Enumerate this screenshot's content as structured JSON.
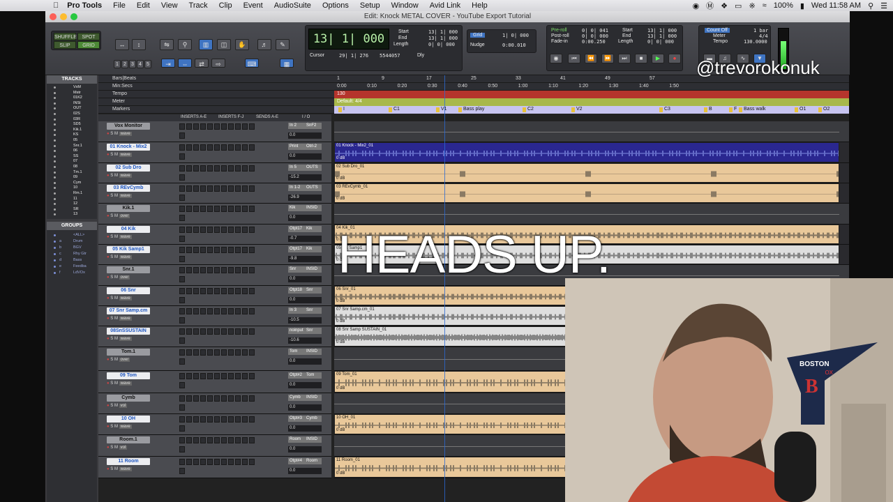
{
  "menubar": {
    "app": "Pro Tools",
    "items": [
      "File",
      "Edit",
      "View",
      "Track",
      "Clip",
      "Event",
      "AudioSuite",
      "Options",
      "Setup",
      "Window",
      "Avid Link",
      "Help"
    ],
    "battery": "100%",
    "clock": "Wed 11:58 AM"
  },
  "window": {
    "title": "Edit: Knock METAL COVER - YouTube Export Tutorial"
  },
  "toolbar": {
    "modes": [
      "SHUFFLE",
      "SPOT",
      "SLIP",
      "GRID"
    ],
    "zoom_presets": [
      "1",
      "2",
      "3",
      "4",
      "5"
    ],
    "main_counter": "13| 1| 000",
    "cursor_label": "Cursor",
    "cursor_value": "29| 1| 276",
    "sample_value": "5544057",
    "selection": {
      "start_label": "Start",
      "end_label": "End",
      "length_label": "Length",
      "start": "13| 1| 000",
      "end": "13| 1| 000",
      "length": "0| 0| 000"
    },
    "dly_label": "Dly",
    "grid_label": "Grid",
    "grid_value": "1| 0| 000",
    "nudge_label": "Nudge",
    "nudge_value": "0:00.010",
    "transport": {
      "preroll_label": "Pre-roll",
      "postroll_label": "Post-roll",
      "fadein_label": "Fade-in",
      "preroll": "0| 0| 041",
      "postroll": "0| 0| 000",
      "fadein": "0:00.250",
      "start_label": "Start",
      "end_label": "End",
      "length_label": "Length",
      "start": "13| 1| 000",
      "end": "13| 1| 000",
      "length": "0| 0| 000"
    },
    "countoff_label": "Count Off",
    "countoff_value": "1 bar",
    "meter_label": "Meter",
    "meter_value": "4/4",
    "tempo_label": "Tempo",
    "tempo_value": "130.0000"
  },
  "tracklist": {
    "title": "TRACKS",
    "items": [
      "VxM",
      "Mstr",
      "01K2",
      "INSt",
      "OUT",
      "02S",
      "03R",
      "SD5",
      "Kik.1",
      "KS",
      "05",
      "Snr.1",
      "06",
      "SS",
      "07",
      "08",
      "Tm.1",
      "09",
      "Cym",
      "10",
      "Rm.1",
      "11",
      "12",
      "SR",
      "13"
    ]
  },
  "groups": {
    "title": "GROUPS",
    "items": [
      {
        "letter": "",
        "name": "<ALL>"
      },
      {
        "letter": "a",
        "name": "Drum"
      },
      {
        "letter": "b",
        "name": "BGV"
      },
      {
        "letter": "c",
        "name": "Rhy Gtr"
      },
      {
        "letter": "d",
        "name": "Bass"
      },
      {
        "letter": "e",
        "name": "Feedba"
      },
      {
        "letter": "f",
        "name": "LdVOx"
      }
    ]
  },
  "rulers": {
    "bars_label": "Bars|Beats",
    "minsecs_label": "Min:Secs",
    "tempo_label": "Tempo",
    "meter_label": "Meter",
    "markers_label": "Markers",
    "bar_numbers": [
      "1",
      "9",
      "17",
      "25",
      "33",
      "41",
      "49",
      "57"
    ],
    "min_secs": [
      "0:00",
      "0:10",
      "0:20",
      "0:30",
      "0:40",
      "0:50",
      "1:00",
      "1:10",
      "1:20",
      "1:30",
      "1:40",
      "1:50"
    ],
    "tempo_value": "130",
    "meter_value": "Default: 4/4",
    "markers": [
      "I",
      "C1",
      "V1",
      "Bass play",
      "C2",
      "V2",
      "C3",
      "B",
      "F",
      "Bass walk",
      "O1",
      "O2"
    ]
  },
  "mix_header": {
    "inserts_ae": "INSERTS A-E",
    "inserts_fj": "INSERTS F-J",
    "sends_ae": "SENDS A-E",
    "io": "I / O"
  },
  "tracks": [
    {
      "name": "Vox Monitor",
      "type": "aux",
      "in": "In 2",
      "out": "SnF2",
      "vol": "0.0",
      "view": "wave",
      "clip": "",
      "color": "#aeb3b8"
    },
    {
      "name": "01 Knock - Mix2",
      "type": "audio",
      "in": "Print",
      "out": "Otrl-2",
      "vol": "0.0",
      "view": "wave",
      "clip": "01 Knock - Mix2_01",
      "color": "#2a2790"
    },
    {
      "name": "02 Sub Dro",
      "type": "audio",
      "in": "In 5",
      "out": "OUTS",
      "vol": "-15.2",
      "view": "wave",
      "clip": "02 Sub Dro_01",
      "color": "#e9c89a"
    },
    {
      "name": "03 REvCymb",
      "type": "audio",
      "in": "In 1-2",
      "out": "OUTS",
      "vol": "-26.9",
      "view": "wave",
      "clip": "03 REvCymb_01",
      "color": "#e9c89a"
    },
    {
      "name": "Kik.1",
      "type": "aux",
      "in": "Kik",
      "out": "INSID",
      "vol": "0.0",
      "view": "over",
      "clip": "",
      "color": "#aeb3b8"
    },
    {
      "name": "04 Kik",
      "type": "audio",
      "in": "Otpt17",
      "out": "Kik",
      "vol": "-0.7",
      "view": "wave",
      "clip": "04 Kik_01",
      "color": "#e9c89a"
    },
    {
      "name": "05 Kik Samp1",
      "type": "audio",
      "in": "Otpt17",
      "out": "Kik",
      "vol": "-9.8",
      "view": "wave",
      "clip": "05 Kik Samp1",
      "color": "#dedede"
    },
    {
      "name": "Snr.1",
      "type": "aux",
      "in": "Snr",
      "out": "INSID",
      "vol": "0.0",
      "view": "over",
      "clip": "",
      "color": "#aeb3b8"
    },
    {
      "name": "06 Snr",
      "type": "audio",
      "in": "Otpt18",
      "out": "Snr",
      "vol": "0.0",
      "view": "wave",
      "clip": "06 Snr_01",
      "color": "#e9c89a"
    },
    {
      "name": "07 Snr Samp.cm",
      "type": "audio",
      "in": "In 3",
      "out": "Snr",
      "vol": "-10.5",
      "view": "wave",
      "clip": "07 Snr Samp.cm_01",
      "color": "#dedede"
    },
    {
      "name": "08SnSSUSTAIN",
      "type": "audio",
      "in": "noinput",
      "out": "Snr",
      "vol": "-10.6",
      "view": "wave",
      "clip": "08 Snr Samp SUSTAIN_01",
      "color": "#dedede"
    },
    {
      "name": "Tom.1",
      "type": "aux",
      "in": "Tom",
      "out": "INSID",
      "vol": "0.0",
      "view": "over",
      "clip": "",
      "color": "#e9c89a"
    },
    {
      "name": "09 Tom",
      "type": "audio",
      "in": "Otpt#2",
      "out": "Tom",
      "vol": "0.0",
      "view": "wave",
      "clip": "09 Tom_01",
      "color": "#e9c89a"
    },
    {
      "name": "Cymb",
      "type": "aux",
      "in": "Cymb",
      "out": "INSID",
      "vol": "0.0",
      "view": "vol",
      "clip": "",
      "color": "#e9c89a"
    },
    {
      "name": "10 OH",
      "type": "audio",
      "in": "Otpt#3",
      "out": "Cymb",
      "vol": "0.0",
      "view": "wave",
      "clip": "10 OH_01",
      "color": "#e9c89a"
    },
    {
      "name": "Room.1",
      "type": "aux",
      "in": "Room",
      "out": "INSID",
      "vol": "0.0",
      "view": "vol",
      "clip": "",
      "color": "#e9c89a"
    },
    {
      "name": "11 Room",
      "type": "audio",
      "in": "Otpt#4",
      "out": "Room",
      "vol": "0.0",
      "view": "wave",
      "clip": "11 Room_01",
      "color": "#e9c89a"
    }
  ],
  "overlay": {
    "headline": "HEADS UP.",
    "handle": "@trevorokonuk",
    "pennant_text": "BOSTON RED SOX"
  },
  "colors": {
    "accent": "#3f74c2",
    "lcd": "#b8f0a8",
    "clip_tan": "#e9c89a",
    "clip_blue": "#2a2790"
  }
}
